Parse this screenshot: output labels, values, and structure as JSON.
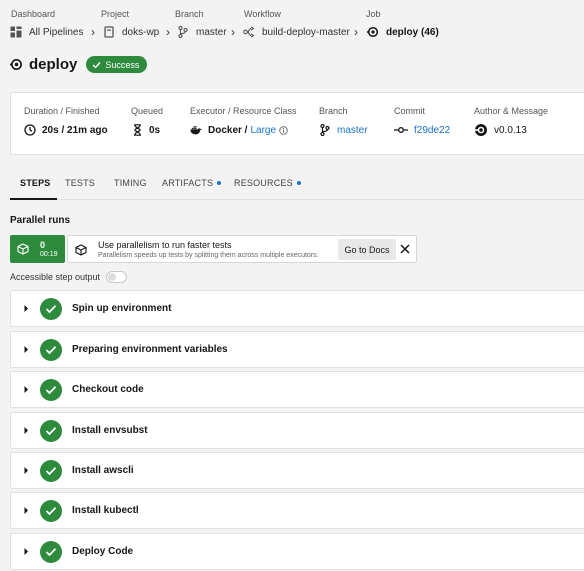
{
  "breadcrumb": {
    "labels": [
      "Dashboard",
      "Project",
      "Branch",
      "Workflow",
      "Job"
    ],
    "items": [
      {
        "icon": "pipelines-icon",
        "text": "All Pipelines"
      },
      {
        "icon": "project-icon",
        "text": "doks-wp"
      },
      {
        "icon": "branch-icon",
        "text": "master"
      },
      {
        "icon": "workflow-icon",
        "text": "build-deploy-master"
      },
      {
        "icon": "job-icon",
        "text": "deploy (46)"
      }
    ],
    "separator": "›"
  },
  "job": {
    "title": "deploy",
    "status": "Success",
    "status_color": "#2e8b3d"
  },
  "summary": {
    "duration": {
      "label": "Duration / Finished",
      "value": "20s / 21m ago"
    },
    "queued": {
      "label": "Queued",
      "value": "0s"
    },
    "executor": {
      "label": "Executor / Resource Class",
      "value": "Docker / ",
      "resource": "Large"
    },
    "branch": {
      "label": "Branch",
      "value": "master"
    },
    "commit": {
      "label": "Commit",
      "value": "f29de22"
    },
    "author": {
      "label": "Author & Message",
      "value": "v0.0.13"
    }
  },
  "tabs": [
    {
      "label": "STEPS",
      "active": true,
      "dot": false
    },
    {
      "label": "TESTS",
      "active": false,
      "dot": false
    },
    {
      "label": "TIMING",
      "active": false,
      "dot": false
    },
    {
      "label": "ARTIFACTS",
      "active": false,
      "dot": true
    },
    {
      "label": "RESOURCES",
      "active": false,
      "dot": true
    }
  ],
  "parallel": {
    "title": "Parallel runs",
    "run_index": "0",
    "run_time": "00:19",
    "promo_heading": "Use parallelism to run faster tests",
    "promo_sub": "Parallelism speeds up tests by splitting them across multiple executors.",
    "docs_button": "Go to Docs"
  },
  "accessible_label": "Accessible step output",
  "steps": [
    "Spin up environment",
    "Preparing environment variables",
    "Checkout code",
    "Install envsubst",
    "Install awscli",
    "Install kubectl",
    "Deploy Code"
  ],
  "colors": {
    "accent": "#1a73c9",
    "success": "#2e8b3d"
  }
}
